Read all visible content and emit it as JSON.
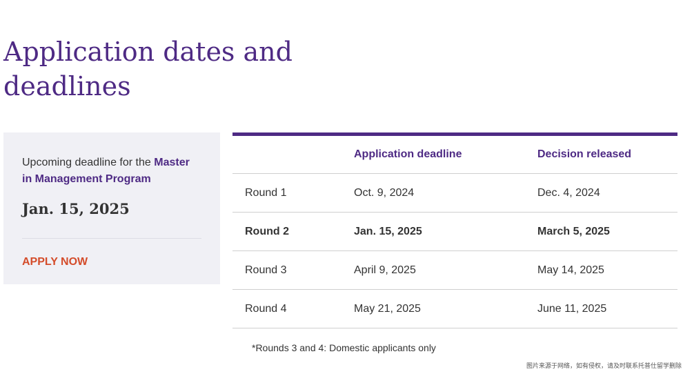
{
  "page": {
    "title": "Application dates and deadlines"
  },
  "card": {
    "intro_prefix": "Upcoming deadline for the ",
    "program": "Master in Management Program",
    "date": "Jan. 15, 2025",
    "apply_label": "APPLY NOW"
  },
  "table": {
    "headers": [
      "",
      "Application deadline",
      "Decision released"
    ],
    "rows": [
      {
        "round": "Round 1",
        "deadline": "Oct. 9, 2024",
        "decision": "Dec. 4, 2024",
        "highlight": false
      },
      {
        "round": "Round 2",
        "deadline": "Jan. 15, 2025",
        "decision": "March 5, 2025",
        "highlight": true
      },
      {
        "round": "Round 3",
        "deadline": "April 9, 2025",
        "decision": "May 14, 2025",
        "highlight": false
      },
      {
        "round": "Round 4",
        "deadline": "May 21, 2025",
        "decision": "June 11, 2025",
        "highlight": false
      }
    ]
  },
  "footnote": "*Rounds 3 and 4: Domestic applicants only",
  "watermark": "图片来源于网络，如有侵权，请及时联系托普仕留学删除",
  "colors": {
    "brand_purple": "#4e2a84",
    "apply_orange": "#d44c2a",
    "card_background": "#f0f0f5"
  }
}
